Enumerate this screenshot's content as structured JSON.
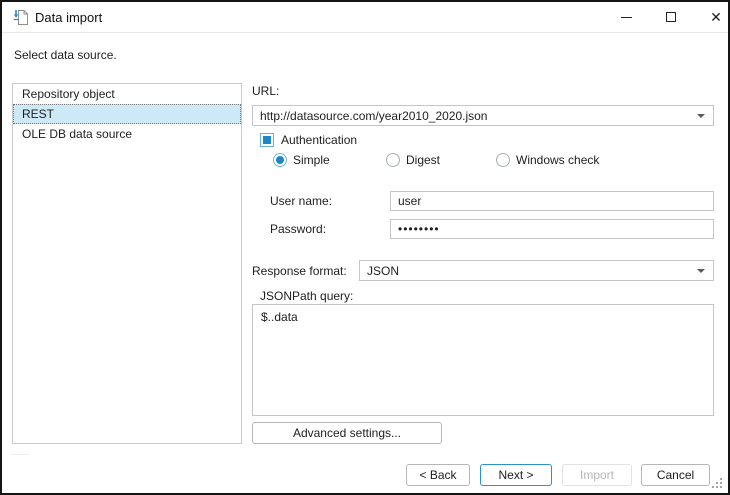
{
  "window": {
    "title": "Data import",
    "subtitle": "Select data source.",
    "close_glyph": "✕"
  },
  "source_list": {
    "items": [
      {
        "label": "Repository object",
        "selected": false
      },
      {
        "label": "REST",
        "selected": true
      },
      {
        "label": "OLE DB data source",
        "selected": false
      }
    ]
  },
  "form": {
    "url": {
      "label": "URL:",
      "value": "http://datasource.com/year2010_2020.json"
    },
    "authentication": {
      "label": "Authentication",
      "checked": true
    },
    "auth_methods": [
      {
        "label": "Simple",
        "selected": true
      },
      {
        "label": "Digest",
        "selected": false
      },
      {
        "label": "Windows check",
        "selected": false
      }
    ],
    "user_name": {
      "label": "User name:",
      "value": "user"
    },
    "password": {
      "label": "Password:",
      "value": "••••••••"
    },
    "response_format": {
      "label": "Response format:",
      "value": "JSON"
    },
    "jsonpath": {
      "label": "JSONPath query:",
      "value": "$..data"
    },
    "advanced_button": "Advanced settings..."
  },
  "footer": {
    "back": "< Back",
    "next": "Next >",
    "import": "Import",
    "cancel": "Cancel"
  },
  "colors": {
    "accent": "#1d87c9",
    "next_border": "#2e8fd0",
    "selection_bg": "#cde8f6",
    "control_border": "#c5c5c5",
    "disabled_text": "#b6b6b6"
  }
}
